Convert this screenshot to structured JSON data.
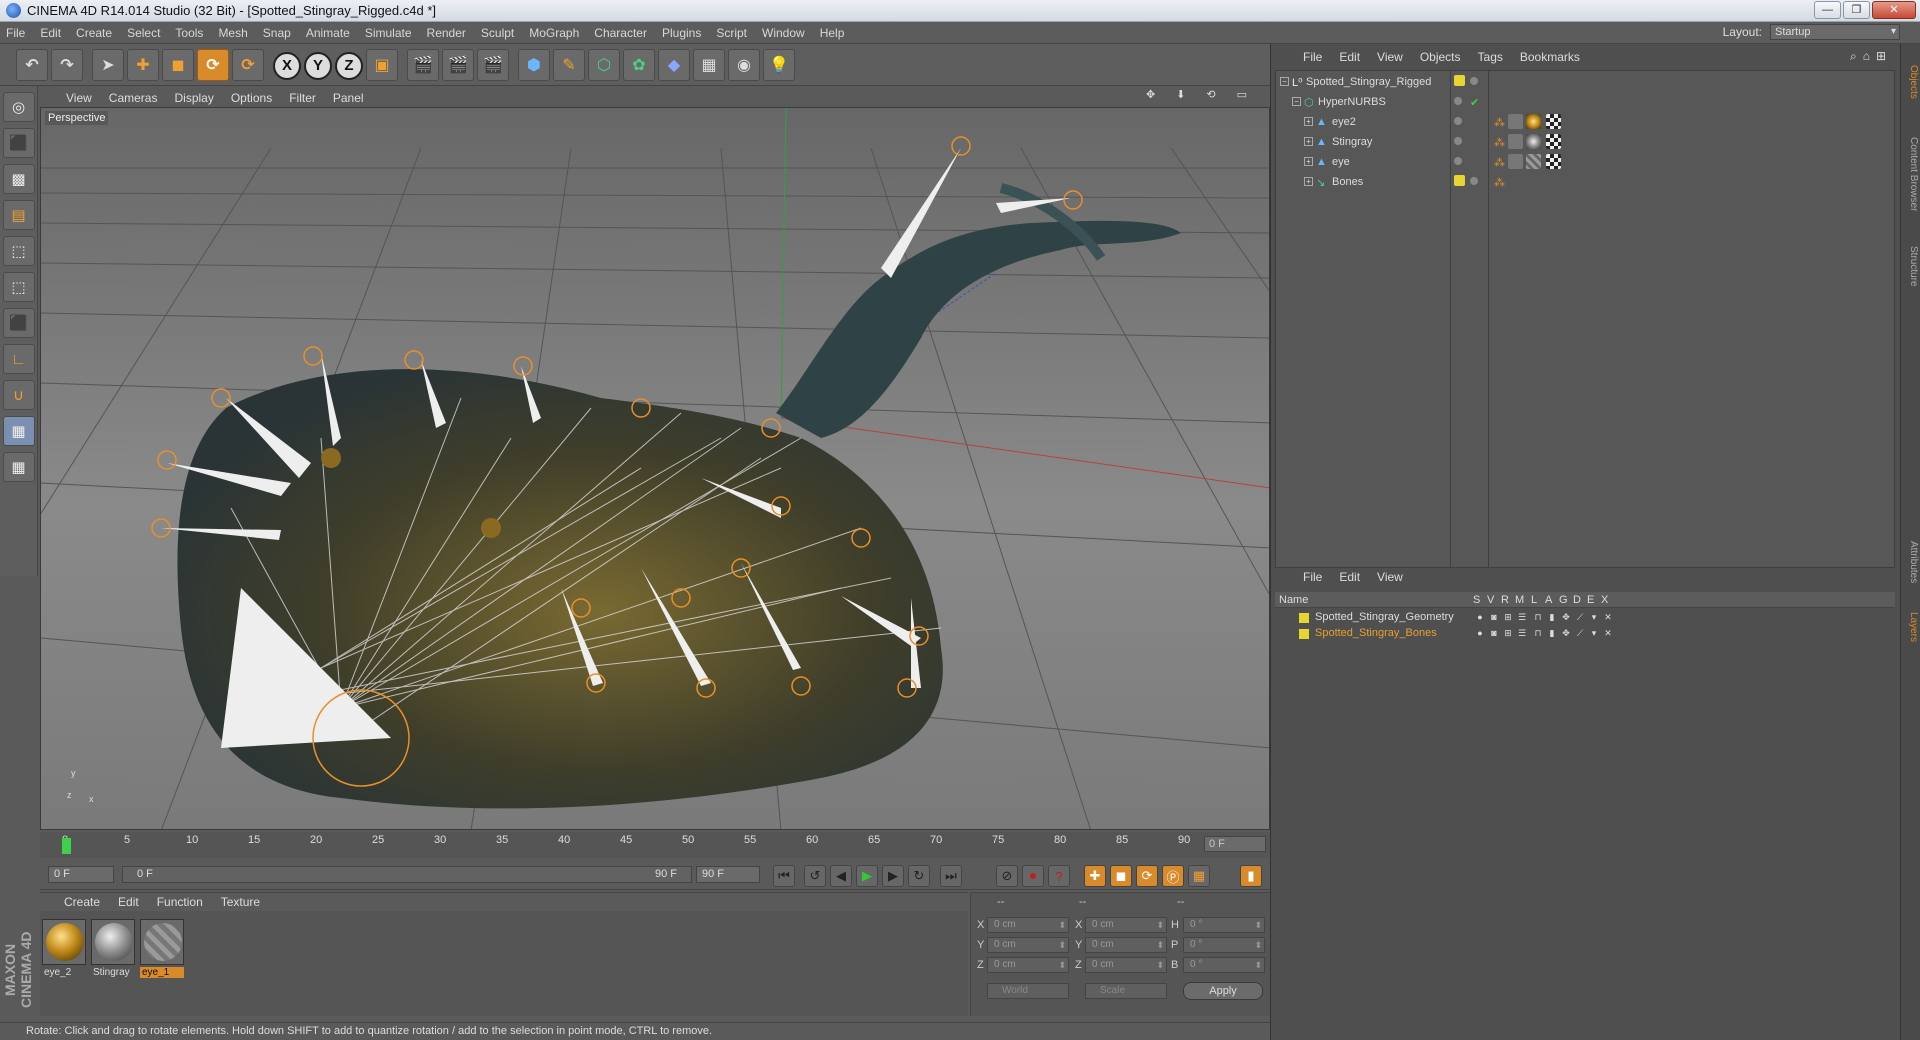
{
  "window": {
    "title": "CINEMA 4D R14.014 Studio (32 Bit) - [Spotted_Stingray_Rigged.c4d *]",
    "min": "—",
    "max": "❐",
    "close": "✕"
  },
  "menu": [
    "File",
    "Edit",
    "Create",
    "Select",
    "Tools",
    "Mesh",
    "Snap",
    "Animate",
    "Simulate",
    "Render",
    "Sculpt",
    "MoGraph",
    "Character",
    "Plugins",
    "Script",
    "Window",
    "Help"
  ],
  "layout": {
    "label": "Layout:",
    "value": "Startup"
  },
  "toolbar": {
    "undo": "↶",
    "redo": "↷",
    "x": "X",
    "y": "Y",
    "z": "Z"
  },
  "viewport": {
    "menu": [
      "View",
      "Cameras",
      "Display",
      "Options",
      "Filter",
      "Panel"
    ],
    "label": "Perspective",
    "axis_y": "y",
    "axis_x": "x",
    "axis_z": "z",
    "nav_icons": [
      "✥",
      "⬇",
      "⟲",
      "▭"
    ]
  },
  "timeline": {
    "ticks": [
      "0",
      "5",
      "10",
      "15",
      "20",
      "25",
      "30",
      "35",
      "40",
      "45",
      "50",
      "55",
      "60",
      "65",
      "70",
      "75",
      "80",
      "85",
      "90"
    ],
    "current_frame": "0 F"
  },
  "transport": {
    "start_field": "0 F",
    "range_start": "0 F",
    "range_end": "90 F",
    "end_field": "90 F"
  },
  "materials": {
    "menu": [
      "Create",
      "Edit",
      "Function",
      "Texture"
    ],
    "items": [
      {
        "name": "eye_2",
        "color": "#c08a1a"
      },
      {
        "name": "Stingray",
        "color": "#8a8a8a"
      },
      {
        "name": "eye_1",
        "color": "#9a9a9a"
      }
    ]
  },
  "coordinates": {
    "header1": "--",
    "header2": "--",
    "header3": "--",
    "rows": [
      {
        "l1": "X",
        "v1": "0 cm",
        "l2": "X",
        "v2": "0 cm",
        "l3": "H",
        "v3": "0 °"
      },
      {
        "l1": "Y",
        "v1": "0 cm",
        "l2": "Y",
        "v2": "0 cm",
        "l3": "P",
        "v3": "0 °"
      },
      {
        "l1": "Z",
        "v1": "0 cm",
        "l2": "Z",
        "v2": "0 cm",
        "l3": "B",
        "v3": "0 °"
      }
    ],
    "space": "World",
    "mode": "Scale",
    "apply": "Apply"
  },
  "status": "Rotate: Click and drag to rotate elements. Hold down SHIFT to add to quantize rotation / add to the selection in point mode, CTRL to remove.",
  "objects": {
    "menu": [
      "File",
      "Edit",
      "View",
      "Objects",
      "Tags",
      "Bookmarks"
    ],
    "items": [
      {
        "name": "Spotted_Stingray_Rigged",
        "indent": 0
      },
      {
        "name": "HyperNURBS",
        "indent": 1
      },
      {
        "name": "eye2",
        "indent": 2
      },
      {
        "name": "Stingray",
        "indent": 2
      },
      {
        "name": "eye",
        "indent": 2
      },
      {
        "name": "Bones",
        "indent": 2
      }
    ]
  },
  "layers": {
    "menu": [
      "File",
      "Edit",
      "View"
    ],
    "columns": [
      "Name",
      "S",
      "V",
      "R",
      "M",
      "L",
      "A",
      "G",
      "D",
      "E",
      "X"
    ],
    "items": [
      {
        "name": "Spotted_Stingray_Geometry",
        "color": "#dddddd"
      },
      {
        "name": "Spotted_Stingray_Bones",
        "color": "#e8a030"
      }
    ]
  },
  "side_tabs": [
    "Objects",
    "Content Browser",
    "Structure",
    "Attributes",
    "Layers"
  ],
  "brand": "MAXON CINEMA 4D"
}
